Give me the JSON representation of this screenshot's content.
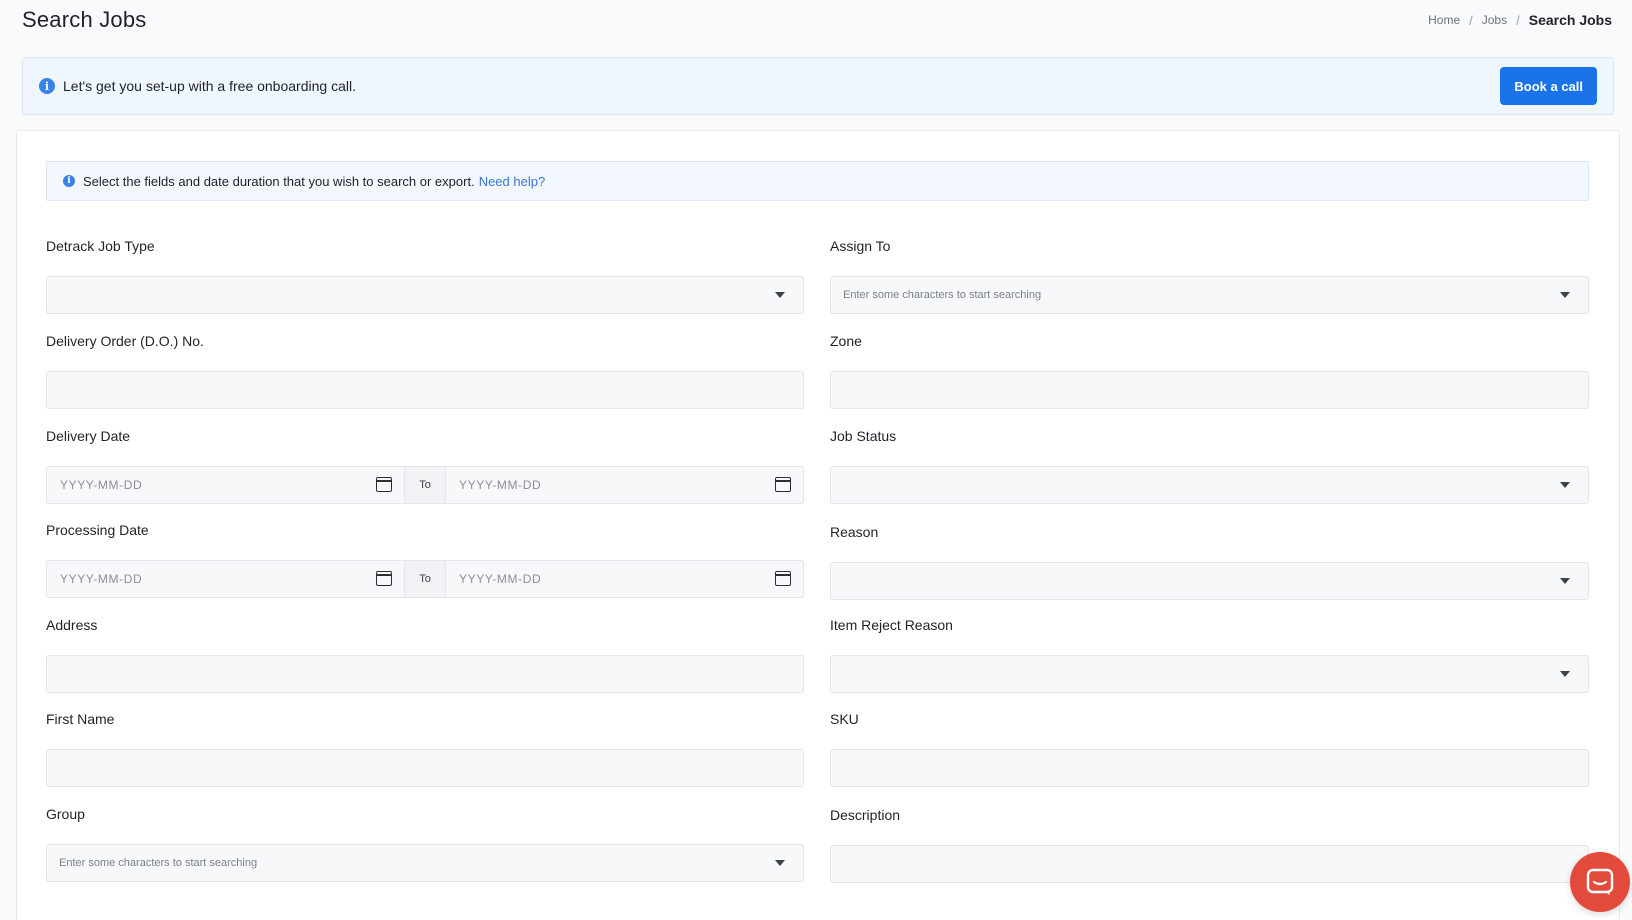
{
  "header": {
    "title": "Search Jobs",
    "breadcrumb": {
      "home": "Home",
      "jobs": "Jobs",
      "current": "Search Jobs",
      "separator": "/"
    }
  },
  "onboarding": {
    "icon": "info-icon",
    "text": "Let's get you set-up with a free onboarding call.",
    "button_label": "Book a call"
  },
  "help": {
    "icon": "info-icon",
    "text": "Select the fields and date duration that you wish to search or export.",
    "link": "Need help?"
  },
  "form": {
    "job_type": {
      "label": "Detrack Job Type",
      "value": ""
    },
    "assign_to": {
      "label": "Assign To",
      "placeholder": "Enter some characters to start searching"
    },
    "do_no": {
      "label": "Delivery Order (D.O.) No.",
      "value": ""
    },
    "zone": {
      "label": "Zone",
      "value": ""
    },
    "delivery_date": {
      "label": "Delivery Date",
      "from_placeholder": "YYYY-MM-DD",
      "to_label": "To",
      "to_placeholder": "YYYY-MM-DD"
    },
    "job_status": {
      "label": "Job Status",
      "value": ""
    },
    "processing_date": {
      "label": "Processing Date",
      "from_placeholder": "YYYY-MM-DD",
      "to_label": "To",
      "to_placeholder": "YYYY-MM-DD"
    },
    "reason": {
      "label": "Reason",
      "value": ""
    },
    "address": {
      "label": "Address",
      "value": ""
    },
    "item_reject_reason": {
      "label": "Item Reject Reason",
      "value": ""
    },
    "first_name": {
      "label": "First Name",
      "value": ""
    },
    "sku": {
      "label": "SKU",
      "value": ""
    },
    "group": {
      "label": "Group",
      "placeholder": "Enter some characters to start searching"
    },
    "description": {
      "label": "Description",
      "value": ""
    }
  },
  "chat": {
    "icon": "chat-icon",
    "color": "#e24b3b"
  }
}
